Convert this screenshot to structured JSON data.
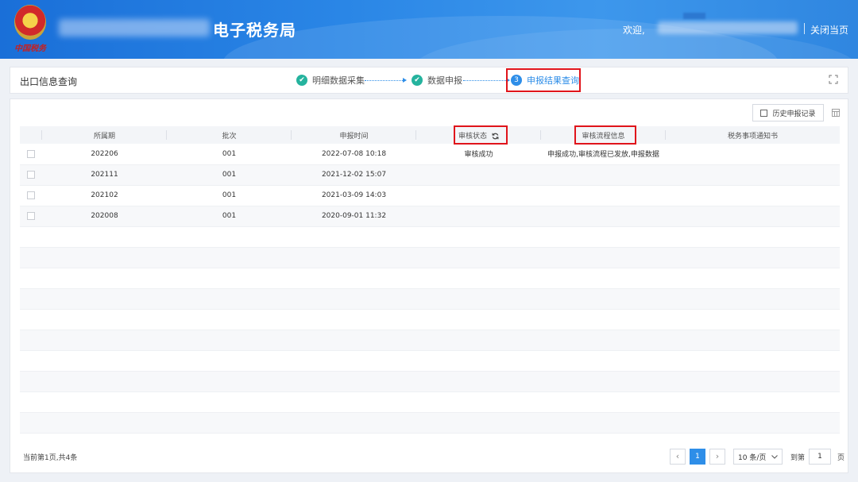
{
  "header": {
    "emblem_text": "中国税务",
    "org_title": "电子税务局",
    "welcome": "欢迎,",
    "close_page": "关闭当页"
  },
  "steps": {
    "panel_title": "出口信息查询",
    "items": [
      {
        "label": "明细数据采集",
        "state": "done"
      },
      {
        "label": "数据申报",
        "state": "done"
      },
      {
        "label": "申报结果查询",
        "state": "active",
        "number": "3"
      }
    ],
    "check_glyph": "✔"
  },
  "toolbar": {
    "history_label": "历史申报记录"
  },
  "table": {
    "columns": [
      "所属期",
      "批次",
      "申报时间",
      "审核状态",
      "审核流程信息",
      "税务事项通知书"
    ],
    "rows": [
      {
        "period": "202206",
        "batch": "001",
        "time": "2022-07-08 10:18",
        "status": "审核成功",
        "flow": "申报成功,审核流程已发放,申报数据",
        "notice": ""
      },
      {
        "period": "202111",
        "batch": "001",
        "time": "2021-12-02 15:07",
        "status": "",
        "flow": "",
        "notice": ""
      },
      {
        "period": "202102",
        "batch": "001",
        "time": "2021-03-09 14:03",
        "status": "",
        "flow": "",
        "notice": ""
      },
      {
        "period": "202008",
        "batch": "001",
        "time": "2020-09-01 11:32",
        "status": "",
        "flow": "",
        "notice": ""
      }
    ]
  },
  "pager": {
    "info": "当前第1页,共4条",
    "prev": "‹",
    "current": "1",
    "next": "›",
    "page_size": "10 条/页",
    "goto_label": "到第",
    "goto_value": "1",
    "page_unit": "页"
  },
  "colors": {
    "accent": "#2e8ee8",
    "done": "#25b39e",
    "highlight": "#e0141b"
  }
}
